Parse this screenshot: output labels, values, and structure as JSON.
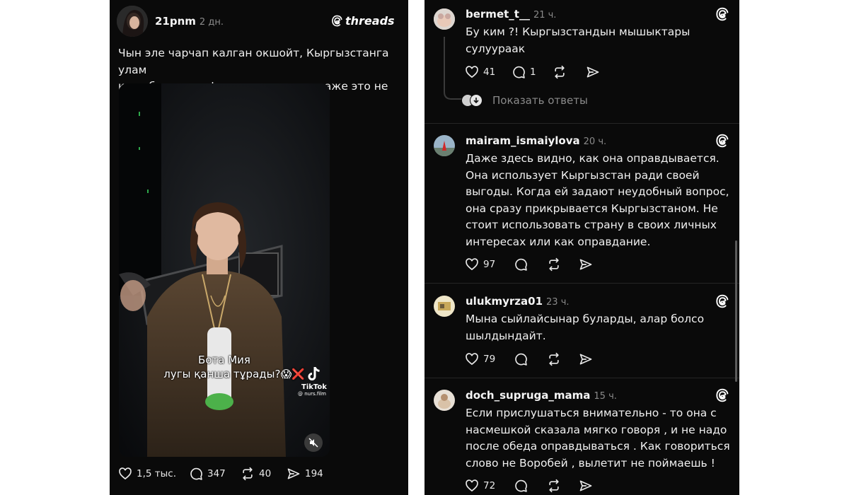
{
  "post": {
    "username": "21pnm",
    "time": "2 дн.",
    "brand": "threads",
    "text_line1": "Чын эле чарчап калган окшойт, Кыргызстанга улам",
    "text_line2": "келе берип , нафиг ее зовете она даже это не ценит",
    "video": {
      "caption_line1": "Бота Мия",
      "caption_line2": "лугы қанша тұрады?😱❌",
      "tiktok_label": "TikTok",
      "tiktok_handle": "@ nurs.film"
    },
    "likes": "1,5 тыс.",
    "replies": "347",
    "reposts": "40",
    "shares": "194"
  },
  "comments": [
    {
      "username": "bermet_t__",
      "time": "21 ч.",
      "text_line1": "Бу ким ?! Кыргызстандын мышыктары",
      "text_line2": "сулуураак",
      "likes": "41",
      "replies": "1",
      "show_replies": "Показать ответы"
    },
    {
      "username": "mairam_ismaiylova",
      "time": "20 ч.",
      "text_line1": "Даже здесь видно, как она оправдывается.",
      "text_line2": "Она использует Кыргызстан ради своей",
      "text_line3": "выгоды. Когда ей задают неудобный вопрос,",
      "text_line4": "она сразу прикрывается Кыргызстаном. Не",
      "text_line5": "стоит использовать страну в своих личных",
      "text_line6": "интересах или как оправдание.",
      "likes": "97"
    },
    {
      "username": "ulukmyrza01",
      "time": "23 ч.",
      "text_line1": "Мына сыйлайсынар буларды, алар болсо",
      "text_line2": "шылдындайт.",
      "likes": "79"
    },
    {
      "username": "doch_supruga_mama",
      "time": "15 ч.",
      "text_line1": "Если прислушаться внимательно - то она с",
      "text_line2": "насмешкой сказала мягко говоря , и не надо",
      "text_line3": "после обеда оправдываться . Как говориться",
      "text_line4": "слово не Воробей , вылетит не поймаешь !",
      "likes": "72"
    }
  ],
  "colors": {
    "background": "#0a0a0a",
    "text": "#f0f0f0",
    "muted": "#8a8a8a",
    "divider": "#262626"
  },
  "icons": [
    "heart-icon",
    "comment-icon",
    "repost-icon",
    "share-icon",
    "threads-logo-icon",
    "mute-icon",
    "tiktok-icon"
  ]
}
